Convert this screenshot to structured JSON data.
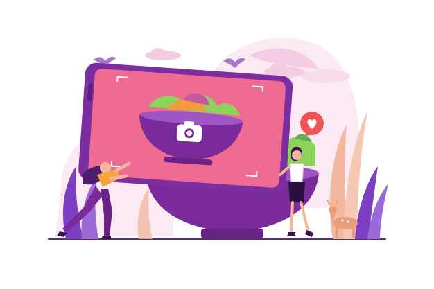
{
  "scene": {
    "colors": {
      "background": "#ffffff",
      "blob_light": "#fbeaf3",
      "blob_mid": "#f4cde4",
      "phone_body": "#7b2ea0",
      "phone_screen": "#ef6b92",
      "bowl_dark": "#7a2a9a",
      "bowl_light": "#9d55c2",
      "salad_green": "#8bd35a",
      "salad_orange": "#f39a3a",
      "heart_badge": "#f05454",
      "grass_purple": "#7c3fc4",
      "plant_peach": "#f4b8a0",
      "deer": "#e8a07a",
      "ground_line": "#5a2a7a"
    },
    "icons": [
      "camera-icon",
      "heart-icon",
      "bird-icon",
      "deer-icon"
    ]
  }
}
